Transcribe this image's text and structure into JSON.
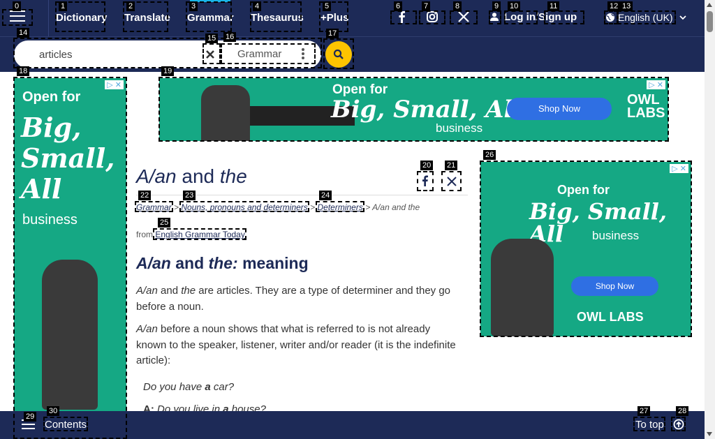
{
  "nav": {
    "links": [
      "Dictionary",
      "Translate",
      "Grammar",
      "Thesaurus",
      "+Plus"
    ],
    "login": "Log in",
    "slash": "/",
    "signup": "Sign up",
    "language": "English (UK)"
  },
  "search": {
    "value": "articles",
    "dictionary": "Grammar"
  },
  "ads": {
    "open_for": "Open for",
    "big": "Big,",
    "small": "Small,",
    "all": "All",
    "big_small_all": "Big, Small, All",
    "business": "business",
    "shop_now": "Shop Now",
    "owl": "OWL",
    "labs": "LABS",
    "owl_labs": "OWL LABS"
  },
  "article": {
    "title_a": "A/an",
    "title_and": " and ",
    "title_the": "the",
    "crumb_grammar": "Grammar",
    "crumb_nouns": "Nouns, pronouns and determiners",
    "crumb_determiners": "Determiners",
    "crumb_current": "A/an and the",
    "crumb_sep": " > ",
    "from": "from",
    "source": "English Grammar Today",
    "h2_a": "A/an",
    "h2_and": " and ",
    "h2_the": "the:",
    "h2_meaning": " meaning",
    "p1_a": "A/an",
    "p1_and": " and ",
    "p1_the": "the",
    "p1_rest": " are articles. They are a type of determiner and they go before a noun.",
    "p2_a": "A/an",
    "p2_rest": " before a noun shows that what is referred to is not already known to the speaker, listener, writer and/or reader (it is the indefinite article):",
    "ex1_pre": "Do you have ",
    "ex1_a": "a",
    "ex1_post": " car?",
    "ex2_speaker": "A:",
    "ex2_pre": " Do you live in ",
    "ex2_a": "a",
    "ex2_post": " house?"
  },
  "bottom": {
    "contents": "Contents",
    "to_top": "To top"
  },
  "markers": [
    "0",
    "1",
    "2",
    "3",
    "4",
    "5",
    "6",
    "7",
    "8",
    "9",
    "10",
    "11",
    "12",
    "13",
    "14",
    "15",
    "16",
    "17",
    "18",
    "19",
    "20",
    "21",
    "22",
    "23",
    "24",
    "25",
    "26",
    "27",
    "28",
    "29",
    "30"
  ],
  "colors": {
    "nav_bg": "#1d2a57",
    "accent": "#fec400",
    "ad_bg": "#15a884",
    "active_tab": "#19b4e6"
  }
}
